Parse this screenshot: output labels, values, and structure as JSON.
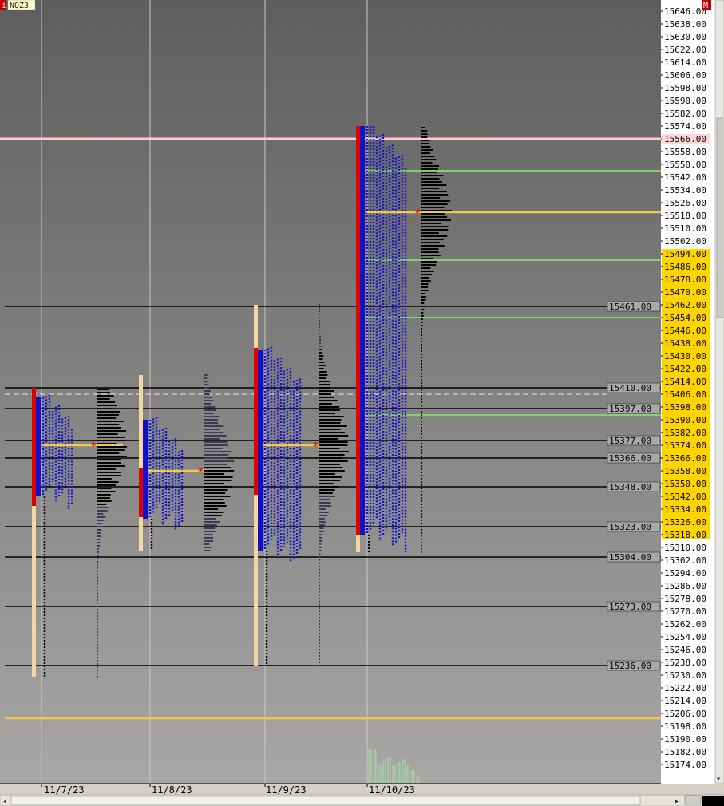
{
  "symbol": "NQZ3",
  "corner_left": "i",
  "corner_right": "M",
  "chart_data": {
    "type": "market-profile",
    "y_range": [
      15166,
      15650
    ],
    "price_ticks": [
      "15646.00",
      "15638.00",
      "15630.00",
      "15622.00",
      "15614.00",
      "15606.00",
      "15598.00",
      "15590.00",
      "15582.00",
      "15574.00",
      "15566.00",
      "15558.00",
      "15550.00",
      "15542.00",
      "15534.00",
      "15526.00",
      "15518.00",
      "15510.00",
      "15502.00",
      "15494.00",
      "15486.00",
      "15478.00",
      "15470.00",
      "15462.00",
      "15454.00",
      "15446.00",
      "15438.00",
      "15430.00",
      "15422.00",
      "15414.00",
      "15406.00",
      "15398.00",
      "15390.00",
      "15382.00",
      "15374.00",
      "15366.00",
      "15358.00",
      "15350.00",
      "15342.00",
      "15334.00",
      "15326.00",
      "15318.00",
      "15310.00",
      "15302.00",
      "15294.00",
      "15286.00",
      "15278.00",
      "15270.00",
      "15262.00",
      "15254.00",
      "15246.00",
      "15238.00",
      "15230.00",
      "15222.00",
      "15214.00",
      "15206.00",
      "15198.00",
      "15190.00",
      "15182.00",
      "15174.00"
    ],
    "highlight_band": [
      15318,
      15494
    ],
    "current_price": 15566,
    "current_price_label": "15566.00",
    "levels": [
      {
        "price": 15461,
        "label": "15461.00"
      },
      {
        "price": 15410,
        "label": "15410.00"
      },
      {
        "price": 15397,
        "label": "15397.00"
      },
      {
        "price": 15377,
        "label": "15377.00"
      },
      {
        "price": 15366,
        "label": "15366.00"
      },
      {
        "price": 15348,
        "label": "15348.00"
      },
      {
        "price": 15323,
        "label": "15323.00"
      },
      {
        "price": 15304,
        "label": "15304.00"
      },
      {
        "price": 15273,
        "label": "15273.00"
      },
      {
        "price": 15236,
        "label": "15236.00"
      }
    ],
    "dashed_level": 15406,
    "yellow_levels": [
      15520,
      15203
    ],
    "green_levels": [
      15546,
      15490,
      15454,
      15393
    ],
    "sessions": [
      {
        "date": "11/7/23",
        "high": 15410,
        "low": 15229,
        "poc": 15374,
        "va": [
          15336,
          15410
        ],
        "tpo_top": 15404,
        "tpo_bot": 15342
      },
      {
        "date": "11/8/23",
        "high": 15418,
        "low": 15308,
        "poc": 15358,
        "va": [
          15329,
          15360
        ],
        "tpo_top": 15390,
        "tpo_bot": 15328
      },
      {
        "date": "11/9/23",
        "high": 15462,
        "low": 15236,
        "poc": 15374,
        "va": [
          15343,
          15435
        ],
        "tpo_top": 15434,
        "tpo_bot": 15308
      },
      {
        "date": "11/10/23",
        "high": 15574,
        "low": 15307,
        "poc": 15520,
        "va": [
          15318,
          15574
        ],
        "tpo_top": 15574,
        "tpo_bot": 15318
      }
    ]
  }
}
